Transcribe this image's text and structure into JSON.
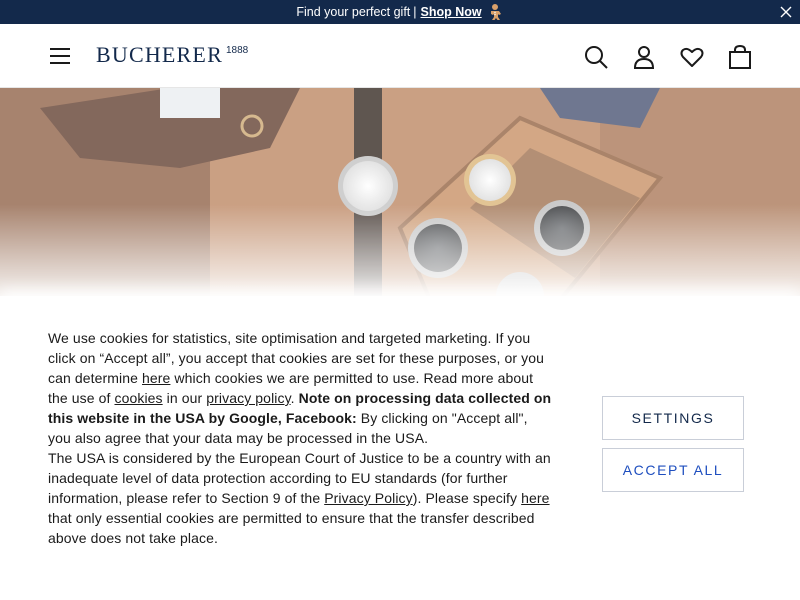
{
  "promo": {
    "text": "Find your perfect gift",
    "separator": "|",
    "link": "Shop Now",
    "gift_icon": "gingerbread-icon",
    "close_icon": "close-icon"
  },
  "header": {
    "logo_word": "BUCHERER",
    "logo_year": "1888",
    "icons": [
      "menu-icon",
      "search-icon",
      "account-icon",
      "wishlist-heart-icon",
      "shopping-bag-icon"
    ]
  },
  "cookie": {
    "p1_a": "We use cookies for statistics, site optimisation and targeted marketing. If you click on “Accept all”, you accept that cookies are set for these purposes, or you can determine ",
    "p1_link_here": "here",
    "p1_b": " which cookies we are permitted to use. Read more about the use of ",
    "p1_link_cookies": "cookies",
    "p1_c": " in our ",
    "p1_link_privacy": "privacy policy",
    "p1_d": ". ",
    "p1_bold": "Note on processing data collected on this website in the USA by Google, Facebook:",
    "p1_e": " By clicking on \"Accept all\", you also agree that your data may be processed in the USA.",
    "p2_a": "The USA is considered by the European Court of Justice to be a country with an inadequate level of data protection according to EU standards (for further information, please refer to Section 9 of the ",
    "p2_link_privacy": "Privacy Policy",
    "p2_b": "). Please specify ",
    "p2_link_here": "here",
    "p2_c": " that only essential cookies are permitted to ensure that the transfer described above does not take place.",
    "settings_label": "SETTINGS",
    "accept_label": "ACCEPT ALL"
  },
  "colors": {
    "brand_navy": "#13294b",
    "accept_blue": "#1f4fbf",
    "promo_bg": "#13294b"
  }
}
